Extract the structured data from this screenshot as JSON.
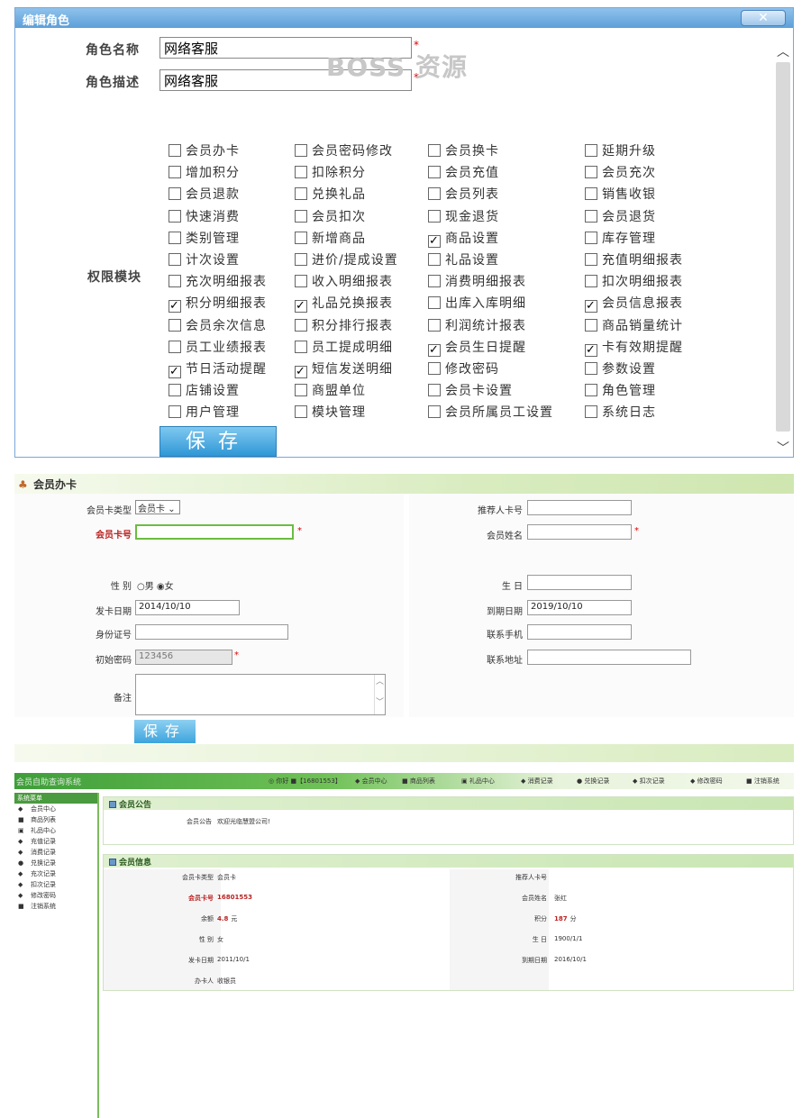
{
  "role_dialog": {
    "title": "编辑角色",
    "close_label": "✕",
    "role_name_label": "角色名称",
    "role_name_value": "网络客服",
    "role_desc_label": "角色描述",
    "role_desc_value": "网络客服",
    "watermark": "BOSS 资源",
    "required_mark": "*",
    "permissions_label": "权限模块",
    "save_label": "保存",
    "permissions": [
      {
        "label": "会员办卡",
        "checked": false
      },
      {
        "label": "会员密码修改",
        "checked": false
      },
      {
        "label": "会员换卡",
        "checked": false
      },
      {
        "label": "延期升级",
        "checked": false
      },
      {
        "label": "增加积分",
        "checked": false
      },
      {
        "label": "扣除积分",
        "checked": false
      },
      {
        "label": "会员充值",
        "checked": false
      },
      {
        "label": "会员充次",
        "checked": false
      },
      {
        "label": "会员退款",
        "checked": false
      },
      {
        "label": "兑换礼品",
        "checked": false
      },
      {
        "label": "会员列表",
        "checked": false
      },
      {
        "label": "销售收银",
        "checked": false
      },
      {
        "label": "快速消费",
        "checked": false
      },
      {
        "label": "会员扣次",
        "checked": false
      },
      {
        "label": "现金退货",
        "checked": false
      },
      {
        "label": "会员退货",
        "checked": false
      },
      {
        "label": "类别管理",
        "checked": false
      },
      {
        "label": "新增商品",
        "checked": false
      },
      {
        "label": "商品设置",
        "checked": true
      },
      {
        "label": "库存管理",
        "checked": false
      },
      {
        "label": "计次设置",
        "checked": false
      },
      {
        "label": "进价/提成设置",
        "checked": false
      },
      {
        "label": "礼品设置",
        "checked": false
      },
      {
        "label": "充值明细报表",
        "checked": false
      },
      {
        "label": "充次明细报表",
        "checked": false
      },
      {
        "label": "收入明细报表",
        "checked": false
      },
      {
        "label": "消费明细报表",
        "checked": false
      },
      {
        "label": "扣次明细报表",
        "checked": false
      },
      {
        "label": "积分明细报表",
        "checked": true
      },
      {
        "label": "礼品兑换报表",
        "checked": true
      },
      {
        "label": "出库入库明细",
        "checked": false
      },
      {
        "label": "会员信息报表",
        "checked": true
      },
      {
        "label": "会员余次信息",
        "checked": false
      },
      {
        "label": "积分排行报表",
        "checked": false
      },
      {
        "label": "利润统计报表",
        "checked": false
      },
      {
        "label": "商品销量统计",
        "checked": false
      },
      {
        "label": "员工业绩报表",
        "checked": false
      },
      {
        "label": "员工提成明细",
        "checked": false
      },
      {
        "label": "会员生日提醒",
        "checked": true
      },
      {
        "label": "卡有效期提醒",
        "checked": true
      },
      {
        "label": "节日活动提醒",
        "checked": true
      },
      {
        "label": "短信发送明细",
        "checked": true
      },
      {
        "label": "修改密码",
        "checked": false
      },
      {
        "label": "参数设置",
        "checked": false
      },
      {
        "label": "店铺设置",
        "checked": false
      },
      {
        "label": "商盟单位",
        "checked": false
      },
      {
        "label": "会员卡设置",
        "checked": false
      },
      {
        "label": "角色管理",
        "checked": false
      },
      {
        "label": "用户管理",
        "checked": false
      },
      {
        "label": "模块管理",
        "checked": false
      },
      {
        "label": "会员所属员工设置",
        "checked": false
      },
      {
        "label": "系统日志",
        "checked": false
      }
    ]
  },
  "card_form": {
    "title": "会员办卡",
    "card_type_label": "会员卡类型",
    "card_type_value": "会员卡",
    "card_no_label": "会员卡号",
    "card_no_value": "",
    "referrer_label": "推荐人卡号",
    "member_name_label": "会员姓名",
    "gender_label": "性 别",
    "gender_male": "男",
    "gender_female": "女",
    "birthday_label": "生 日",
    "issue_date_label": "发卡日期",
    "issue_date_value": "2014/10/10",
    "expire_date_label": "到期日期",
    "expire_date_value": "2019/10/10",
    "id_card_label": "身份证号",
    "phone_label": "联系手机",
    "init_password_label": "初始密码",
    "init_password_value": "123456",
    "address_label": "联系地址",
    "remarks_label": "备注",
    "save_label": "保存",
    "required_mark": "*"
  },
  "member_center": {
    "app_title": "会员自助查询系统",
    "nav": [
      "◎ 你好 ■【16801553】",
      "◆ 会员中心",
      "■ 商品列表",
      "▣ 礼品中心",
      "◆ 消费记录",
      "● 兑换记录",
      "◆ 扣次记录",
      "◆ 修改密码",
      "■ 注销系统"
    ],
    "side_title": "系统菜单",
    "side_items": [
      {
        "icon": "◆",
        "label": "会员中心"
      },
      {
        "icon": "■",
        "label": "商品列表"
      },
      {
        "icon": "▣",
        "label": "礼品中心"
      },
      {
        "icon": "◆",
        "label": "充值记录"
      },
      {
        "icon": "◆",
        "label": "消费记录"
      },
      {
        "icon": "●",
        "label": "兑换记录"
      },
      {
        "icon": "◆",
        "label": "充次记录"
      },
      {
        "icon": "◆",
        "label": "扣次记录"
      },
      {
        "icon": "◆",
        "label": "修改密码"
      },
      {
        "icon": "■",
        "label": "注销系统"
      }
    ],
    "notice_title": "会员公告",
    "notice_label": "会员公告",
    "notice_value": "欢迎光临慧盟公司!",
    "info_title": "会员信息",
    "info_left": [
      {
        "key": "会员卡类型",
        "value": "会员卡",
        "red": false
      },
      {
        "key": "会员卡号",
        "value": "16801553",
        "red": true
      },
      {
        "key": "余额",
        "value": "4.8",
        "unit": "元",
        "red": false
      },
      {
        "key": "性 别",
        "value": "女",
        "red": false
      },
      {
        "key": "发卡日期",
        "value": "2011/10/1",
        "red": false
      },
      {
        "key": "办卡人",
        "value": "收银员",
        "red": false
      }
    ],
    "info_right": [
      {
        "key": "推荐人卡号",
        "value": "",
        "red": false
      },
      {
        "key": "会员姓名",
        "value": "张红",
        "red": false
      },
      {
        "key": "积分",
        "value": "187",
        "unit": "分",
        "red": false
      },
      {
        "key": "生 日",
        "value": "1900/1/1",
        "red": false
      },
      {
        "key": "到期日期",
        "value": "2016/10/1",
        "red": false
      }
    ]
  }
}
